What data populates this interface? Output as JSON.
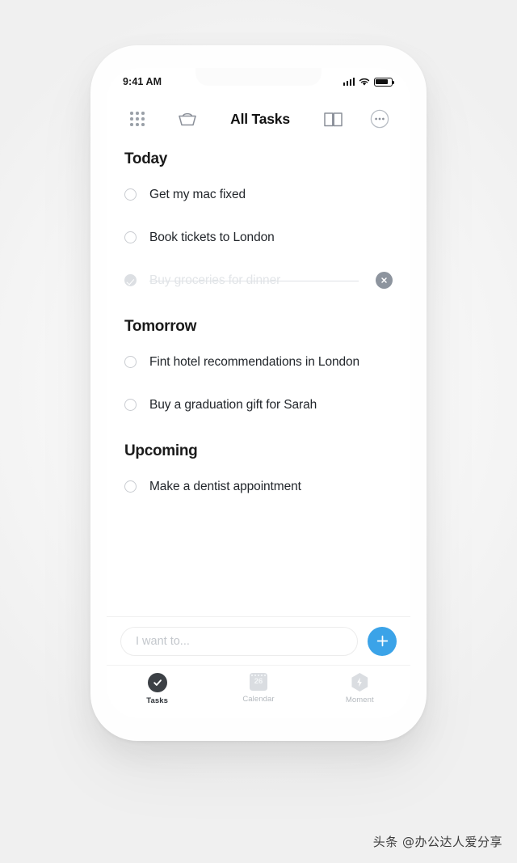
{
  "status_bar": {
    "time": "9:41 AM",
    "signal_icon": "signal-bars-icon",
    "wifi_icon": "wifi-icon",
    "battery_icon": "battery-icon"
  },
  "navbar": {
    "title": "All Tasks",
    "grid_icon": "grid-dots-icon",
    "basket_icon": "basket-icon",
    "book_icon": "open-book-icon",
    "more_icon": "more-options-icon"
  },
  "sections": [
    {
      "title": "Today",
      "tasks": [
        {
          "label": "Get my mac fixed",
          "completed": false
        },
        {
          "label": "Book tickets to London",
          "completed": false
        },
        {
          "label": "Buy groceries for dinner",
          "completed": true
        }
      ]
    },
    {
      "title": "Tomorrow",
      "tasks": [
        {
          "label": "Fint hotel recommendations in London",
          "completed": false
        },
        {
          "label": "Buy a graduation gift for Sarah",
          "completed": false
        }
      ]
    },
    {
      "title": "Upcoming",
      "tasks": [
        {
          "label": "Make a dentist appointment",
          "completed": false
        }
      ]
    }
  ],
  "composer": {
    "placeholder": "I want to...",
    "value": "",
    "add_icon": "plus-icon",
    "add_button_color": "#3ba3e8"
  },
  "tabbar": {
    "tabs": [
      {
        "label": "Tasks",
        "icon": "check-circle-icon",
        "active": true
      },
      {
        "label": "Calendar",
        "icon": "calendar-icon",
        "day": "26",
        "active": false
      },
      {
        "label": "Moment",
        "icon": "hexagon-bolt-icon",
        "active": false
      }
    ]
  },
  "watermark": {
    "text": "头条 @办公达人爱分享"
  }
}
